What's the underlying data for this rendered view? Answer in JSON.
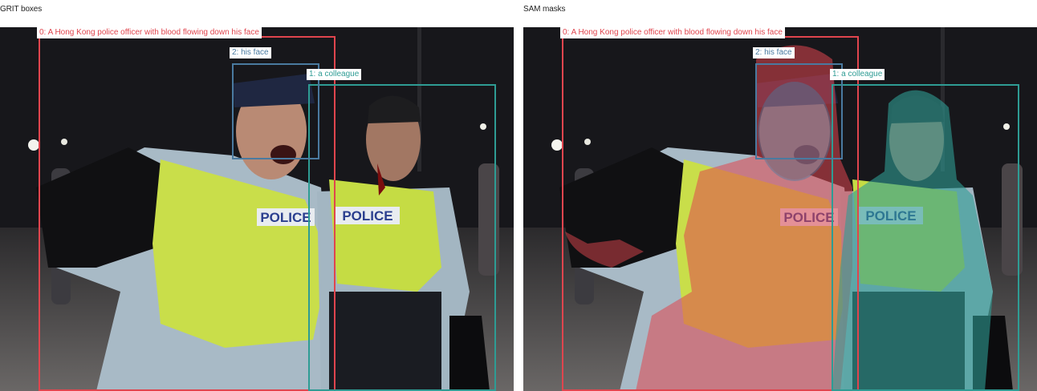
{
  "panels": {
    "left_title": "GRIT boxes",
    "right_title": "SAM masks"
  },
  "detections": [
    {
      "id": 0,
      "label": "0: A Hong Kong police officer with blood flowing down his face",
      "color": "#e0454e"
    },
    {
      "id": 1,
      "label": "1: a colleague",
      "color": "#2e9c94"
    },
    {
      "id": 2,
      "label": "2: his face",
      "color": "#4a7aa0"
    }
  ],
  "scene": {
    "vest_text_1": "POLICE",
    "vest_text_2": "POLICE"
  },
  "colors": {
    "mask_officer": "#e0454e",
    "mask_colleague": "#2e9c94",
    "mask_face": "#4a7aa0",
    "vest": "#c9de4a",
    "shirt": "#aebfcc",
    "night_bg": "#1a1a1f"
  }
}
